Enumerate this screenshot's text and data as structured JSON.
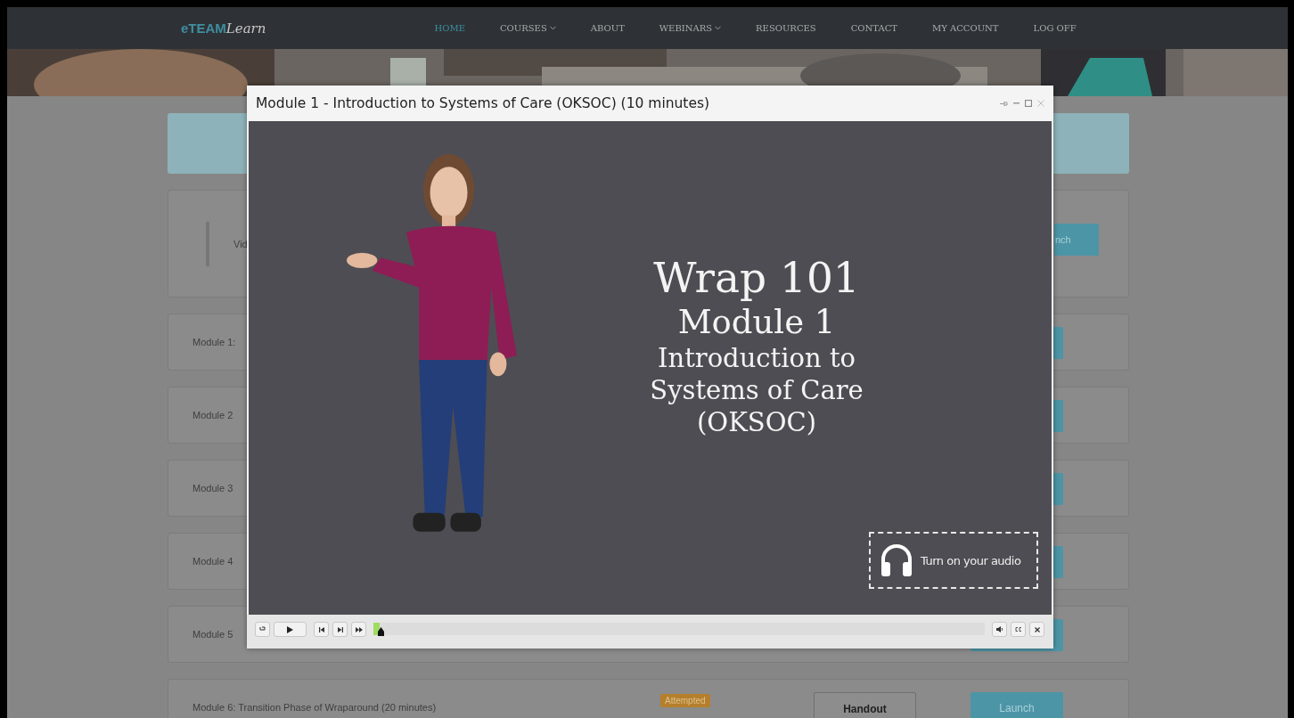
{
  "nav": {
    "logo": {
      "brand": "eTEAM",
      "script": "Learn"
    },
    "items": [
      {
        "label": "HOME",
        "selected": true,
        "has_menu": false
      },
      {
        "label": "COURSES",
        "selected": false,
        "has_menu": true
      },
      {
        "label": "ABOUT",
        "selected": false,
        "has_menu": false
      },
      {
        "label": "WEBINARS",
        "selected": false,
        "has_menu": true
      },
      {
        "label": "RESOURCES",
        "selected": false,
        "has_menu": false
      },
      {
        "label": "CONTACT",
        "selected": false,
        "has_menu": false
      },
      {
        "label": "MY ACCOUNT",
        "selected": false,
        "has_menu": false
      },
      {
        "label": "LOG OFF",
        "selected": false,
        "has_menu": false
      }
    ]
  },
  "intro_card": {
    "text": "Vid",
    "button": "nch"
  },
  "modules": [
    {
      "title": "Module 1:"
    },
    {
      "title": "Module 2"
    },
    {
      "title": "Module 3"
    },
    {
      "title": "Module 4"
    },
    {
      "title": "Module 5"
    },
    {
      "title": "Module 6: Transition Phase of Wraparound (20 minutes)",
      "status": "Attempted",
      "handout": "Handout",
      "launch": "Launch"
    }
  ],
  "player": {
    "title": "Module 1 - Introduction to Systems of Care (OKSOC) (10 minutes)",
    "slide": {
      "heading": "Wrap 101",
      "subheading": "Module 1",
      "lines": [
        "Introduction to",
        "Systems of Care",
        "(OKSOC)"
      ],
      "audio_note": "Turn on your audio"
    },
    "seek": {
      "level": 0.01
    }
  }
}
